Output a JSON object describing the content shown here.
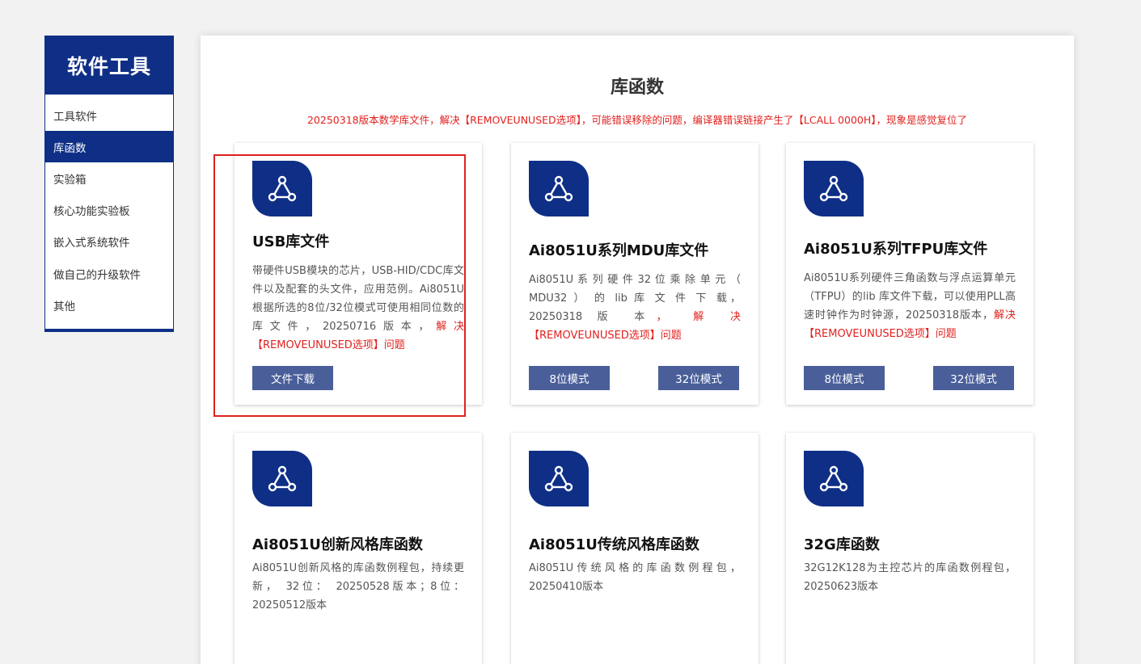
{
  "sidebar": {
    "title": "软件工具",
    "items": [
      {
        "label": "工具软件"
      },
      {
        "label": "库函数"
      },
      {
        "label": "实验箱"
      },
      {
        "label": "核心功能实验板"
      },
      {
        "label": "嵌入式系统软件"
      },
      {
        "label": "做自己的升级软件"
      },
      {
        "label": "其他"
      }
    ],
    "active_index": 1
  },
  "main": {
    "title": "库函数",
    "notice": "20250318版本数学库文件，解决【REMOVEUNUSED选项】，可能错误移除的问题，编译器错误链接产生了【LCALL   0000H】，现象是感觉复位了",
    "cards": [
      {
        "icon": "network-icon",
        "title": "USB库文件",
        "desc": "带硬件USB模块的芯片，USB-HID/CDC库文件以及配套的头文件，应用范例。Ai8051U根据所选的8位/32位模式可使用相同位数的库文件，20250716版本，",
        "desc_red": "解决【REMOVEUNUSED选项】问题",
        "button": "文件下载"
      },
      {
        "icon": "network-icon",
        "title": "Ai8051U系列MDU库文件",
        "desc": "Ai8051U 系 列 硬 件 32 位 乘 除 单 元 （ MDU32 ） 的 lib 库 文 件 下 载， 20250318 版 本",
        "desc_red": "， 解 决【REMOVEUNUSED选项】问题",
        "button_left": "8位模式",
        "button_right": "32位模式"
      },
      {
        "icon": "network-icon",
        "title": "Ai8051U系列TFPU库文件",
        "desc": "Ai8051U系列硬件三角函数与浮点运算单元（TFPU）的lib 库文件下载，可以使用PLL高速时钟作为时钟源，20250318版本，",
        "desc_red": "解决【REMOVEUNUSED选项】问题",
        "button_left": "8位模式",
        "button_right": "32位模式"
      },
      {
        "icon": "network-icon",
        "title": "Ai8051U创新风格库函数",
        "desc": "Ai8051U创新风格的库函数例程包，持续更新， 32位： 20250528版本；8位：20250512版本"
      },
      {
        "icon": "network-icon",
        "title": "Ai8051U传统风格库函数",
        "desc": "Ai8051U传统风格的库函数例程包，20250410版本"
      },
      {
        "icon": "network-icon",
        "title": "32G库函数",
        "desc": "32G12K128为主控芯片的库函数例程包，20250623版本"
      }
    ]
  },
  "colors": {
    "brand": "#0f2f87",
    "button": "#4a5f9a",
    "alert": "#e0211e"
  }
}
